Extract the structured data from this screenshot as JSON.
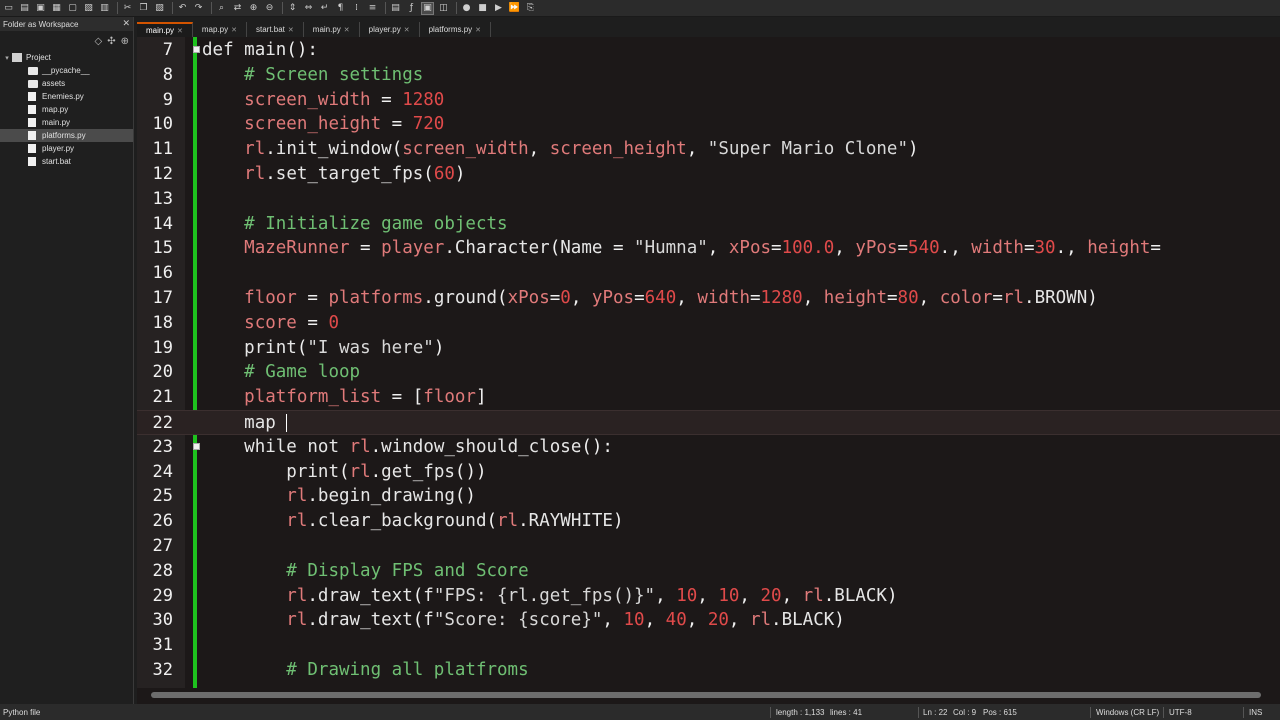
{
  "toolbar": {
    "icons": [
      "new-file-icon",
      "open-icon",
      "save-icon",
      "save-all-icon",
      "close-icon",
      "close-all-icon",
      "print-icon",
      "cut-icon",
      "copy-icon",
      "paste-icon",
      "undo-icon",
      "redo-icon",
      "find-icon",
      "replace-icon",
      "zoom-in-icon",
      "zoom-out-icon",
      "sync-v-icon",
      "sync-h-icon",
      "wrap-icon",
      "show-all-chars-icon",
      "indent-guide-icon",
      "lang-icon",
      "map-icon",
      "function-list-icon",
      "folder-workspace-icon",
      "monitor-icon",
      "record-icon",
      "stop-icon",
      "play-icon",
      "play-multi-icon",
      "save-macro-icon"
    ]
  },
  "sidebar": {
    "title": "Folder as Workspace",
    "close": "✕",
    "tools": [
      "◇",
      "✣",
      "⊕"
    ],
    "tree": [
      {
        "label": "Project",
        "type": "project",
        "depth": 0,
        "expanded": true
      },
      {
        "label": "__pycache__",
        "type": "folder",
        "depth": 1
      },
      {
        "label": "assets",
        "type": "folder",
        "depth": 1
      },
      {
        "label": "Enemies.py",
        "type": "file",
        "depth": 1
      },
      {
        "label": "map.py",
        "type": "file",
        "depth": 1
      },
      {
        "label": "main.py",
        "type": "file",
        "depth": 1
      },
      {
        "label": "platforms.py",
        "type": "file",
        "depth": 1,
        "selected": true
      },
      {
        "label": "player.py",
        "type": "file",
        "depth": 1
      },
      {
        "label": "start.bat",
        "type": "file",
        "depth": 1
      }
    ]
  },
  "tabs": [
    {
      "label": "main.py",
      "active": true
    },
    {
      "label": "map.py"
    },
    {
      "label": "start.bat"
    },
    {
      "label": "main.py"
    },
    {
      "label": "player.py"
    },
    {
      "label": "platforms.py"
    }
  ],
  "editor": {
    "current_line": 22,
    "lines": [
      {
        "n": "7",
        "code": "def main():"
      },
      {
        "n": "8",
        "code": "    # Screen settings"
      },
      {
        "n": "9",
        "code": "    screen_width = 1280"
      },
      {
        "n": "10",
        "code": "    screen_height = 720"
      },
      {
        "n": "11",
        "code": "    rl.init_window(screen_width, screen_height, \"Super Mario Clone\")"
      },
      {
        "n": "12",
        "code": "    rl.set_target_fps(60)"
      },
      {
        "n": "13",
        "code": ""
      },
      {
        "n": "14",
        "code": "    # Initialize game objects"
      },
      {
        "n": "15",
        "code": "    MazeRunner = player.Character(Name = \"Humna\", xPos=100.0, yPos=540., width=30., height="
      },
      {
        "n": "16",
        "code": ""
      },
      {
        "n": "17",
        "code": "    floor = platforms.ground(xPos=0, yPos=640, width=1280, height=80, color=rl.BROWN)"
      },
      {
        "n": "18",
        "code": "    score = 0"
      },
      {
        "n": "19",
        "code": "    print(\"I was here\")"
      },
      {
        "n": "20",
        "code": "    # Game loop"
      },
      {
        "n": "21",
        "code": "    platform_list = [floor]"
      },
      {
        "n": "22",
        "code": "    map "
      },
      {
        "n": "23",
        "code": "    while not rl.window_should_close():"
      },
      {
        "n": "24",
        "code": "        print(rl.get_fps())"
      },
      {
        "n": "25",
        "code": "        rl.begin_drawing()"
      },
      {
        "n": "26",
        "code": "        rl.clear_background(rl.RAYWHITE)"
      },
      {
        "n": "27",
        "code": ""
      },
      {
        "n": "28",
        "code": "        # Display FPS and Score"
      },
      {
        "n": "29",
        "code": "        rl.draw_text(f\"FPS: {rl.get_fps()}\", 10, 10, 20, rl.BLACK)"
      },
      {
        "n": "30",
        "code": "        rl.draw_text(f\"Score: {score}\", 10, 40, 20, rl.BLACK)"
      },
      {
        "n": "31",
        "code": ""
      },
      {
        "n": "32",
        "code": "        # Drawing all platfroms"
      }
    ]
  },
  "status": {
    "language": "Python file",
    "length": "length : 1,133",
    "lines": "lines : 41",
    "ln": "Ln : 22",
    "col": "Col : 9",
    "pos": "Pos : 615",
    "eol": "Windows (CR LF)",
    "encoding": "UTF-8",
    "mode": "INS"
  },
  "colors": {
    "accent": "#d35400",
    "fold_bar": "#1ec21e",
    "comment": "#6fbf73",
    "number": "#e04a4a",
    "identifier": "#e07a7a"
  }
}
